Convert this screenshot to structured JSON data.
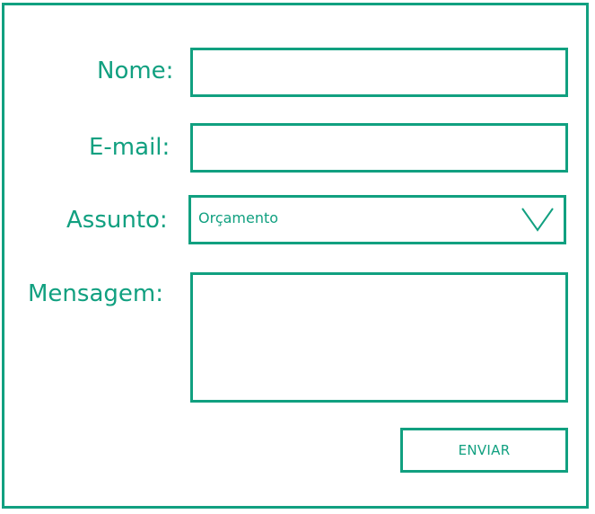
{
  "form": {
    "fields": {
      "name": {
        "label": "Nome:",
        "value": "",
        "placeholder": ""
      },
      "email": {
        "label": "E-mail:",
        "value": "",
        "placeholder": ""
      },
      "subject": {
        "label": "Assunto:",
        "selected": "Orçamento"
      },
      "message": {
        "label": "Mensagem:",
        "value": "",
        "placeholder": ""
      }
    },
    "submit_label": "ENVIAR",
    "icons": {
      "subject_dropdown": "chevron-down-icon"
    },
    "colors": {
      "accent": "#11a080",
      "background": "#ffffff"
    }
  }
}
